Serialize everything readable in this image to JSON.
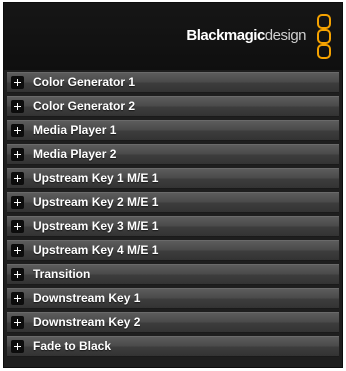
{
  "header": {
    "brand_bold": "Blackmagic",
    "brand_light": "design",
    "logo_icon": "blackmagic-logo-icon",
    "accent": "#f5a200"
  },
  "sections": [
    {
      "label": "Color Generator 1",
      "icon": "expand-plus-icon"
    },
    {
      "label": "Color Generator 2",
      "icon": "expand-plus-icon"
    },
    {
      "label": "Media Player 1",
      "icon": "expand-plus-icon"
    },
    {
      "label": "Media Player 2",
      "icon": "expand-plus-icon"
    },
    {
      "label": "Upstream Key 1 M/E 1",
      "icon": "expand-plus-icon"
    },
    {
      "label": "Upstream Key 2 M/E 1",
      "icon": "expand-plus-icon"
    },
    {
      "label": "Upstream Key 3 M/E 1",
      "icon": "expand-plus-icon"
    },
    {
      "label": "Upstream Key 4 M/E 1",
      "icon": "expand-plus-icon"
    },
    {
      "label": "Transition",
      "icon": "expand-plus-icon"
    },
    {
      "label": "Downstream Key 1",
      "icon": "expand-plus-icon"
    },
    {
      "label": "Downstream Key 2",
      "icon": "expand-plus-icon"
    },
    {
      "label": "Fade to Black",
      "icon": "expand-plus-icon"
    }
  ]
}
